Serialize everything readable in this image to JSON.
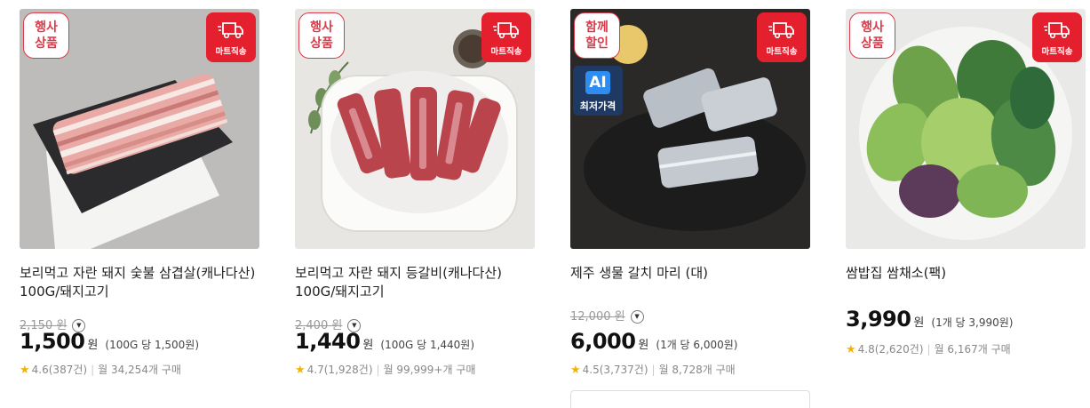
{
  "products": [
    {
      "badge_event": [
        "행사",
        "상품"
      ],
      "badge_mart": "마트직송",
      "name_lines": [
        "보리먹고 자란 돼지 숯불 삼겹살(캐나다산)",
        "100G/돼지고기"
      ],
      "original_price": "2,150",
      "original_unit": "원",
      "price": "1,500",
      "currency": "원",
      "unit_price": "(100G 당 1,500원)",
      "rating": "4.6",
      "reviews": "(387건)",
      "monthly": "월 34,254개 구매"
    },
    {
      "badge_event": [
        "행사",
        "상품"
      ],
      "badge_mart": "마트직송",
      "name_lines": [
        "보리먹고 자란 돼지 등갈비(캐나다산)",
        "100G/돼지고기"
      ],
      "original_price": "2,400",
      "original_unit": "원",
      "price": "1,440",
      "currency": "원",
      "unit_price": "(100G 당 1,440원)",
      "rating": "4.7",
      "reviews": "(1,928건)",
      "monthly": "월 99,999+개 구매"
    },
    {
      "badge_event": [
        "함께",
        "할인"
      ],
      "badge_mart": "마트직송",
      "badge_ai": {
        "label": "AI",
        "sub": "최저가격"
      },
      "name_lines": [
        "제주 생물 갈치 마리 (대)"
      ],
      "original_price": "12,000",
      "original_unit": "원",
      "price": "6,000",
      "currency": "원",
      "unit_price": "(1개 당 6,000원)",
      "rating": "4.5",
      "reviews": "(3,737건)",
      "monthly": "월 8,728개 구매"
    },
    {
      "badge_event": [
        "행사",
        "상품"
      ],
      "badge_mart": "마트직송",
      "name_lines": [
        "쌈밥집 쌈채소(팩)"
      ],
      "price": "3,990",
      "currency": "원",
      "unit_price": "(1개 당 3,990원)",
      "rating": "4.8",
      "reviews": "(2,620건)",
      "monthly": "월 6,167개 구매"
    }
  ],
  "icons": {
    "star": "star-icon",
    "truck": "delivery-truck-icon",
    "chevron": "chevron-down-icon"
  },
  "colors": {
    "badge_red": "#e5202e",
    "event_border": "#d93b4a",
    "star": "#f5b300",
    "ai_navy": "#1e3a63",
    "ai_blue": "#2f8cf0"
  }
}
